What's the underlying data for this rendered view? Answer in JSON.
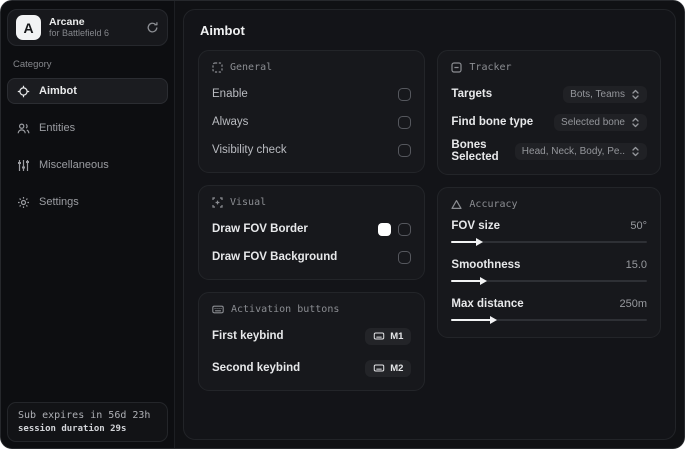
{
  "brand": {
    "logo_letter": "A",
    "name": "Arcane",
    "subtitle": "for Battlefield 6"
  },
  "sidebar": {
    "category_label": "Category",
    "items": [
      {
        "label": "Aimbot",
        "icon": "crosshair-icon",
        "active": true
      },
      {
        "label": "Entities",
        "icon": "users-icon",
        "active": false
      },
      {
        "label": "Miscellaneous",
        "icon": "sliders-icon",
        "active": false
      },
      {
        "label": "Settings",
        "icon": "gear-icon",
        "active": false
      }
    ],
    "footer": {
      "line1": "Sub expires in 56d 23h",
      "line2": "session duration 29s"
    }
  },
  "main": {
    "title": "Aimbot",
    "general": {
      "header": "General",
      "rows": [
        {
          "label": "Enable",
          "checked": false
        },
        {
          "label": "Always",
          "checked": false
        },
        {
          "label": "Visibility check",
          "checked": false
        }
      ]
    },
    "visual": {
      "header": "Visual",
      "rows": [
        {
          "label": "Draw FOV Border",
          "swatch_color": "#ffffff",
          "checked": false
        },
        {
          "label": "Draw FOV Background",
          "checked": false
        }
      ]
    },
    "activation": {
      "header": "Activation buttons",
      "rows": [
        {
          "label": "First keybind",
          "key": "M1"
        },
        {
          "label": "Second keybind",
          "key": "M2"
        }
      ]
    },
    "tracker": {
      "header": "Tracker",
      "rows": [
        {
          "label": "Targets",
          "value": "Bots, Teams"
        },
        {
          "label": "Find bone type",
          "value": "Selected bone"
        },
        {
          "label": "Bones Selected",
          "value": "Head, Neck, Body, Pe.."
        }
      ]
    },
    "accuracy": {
      "header": "Accuracy",
      "rows": [
        {
          "label": "FOV size",
          "value": "50°",
          "percent": 13
        },
        {
          "label": "Smoothness",
          "value": "15.0",
          "percent": 15
        },
        {
          "label": "Max distance",
          "value": "250m",
          "percent": 20
        }
      ]
    }
  },
  "colors": {
    "fov_border_swatch": "#ffffff",
    "accent": "#f2f3f4"
  }
}
